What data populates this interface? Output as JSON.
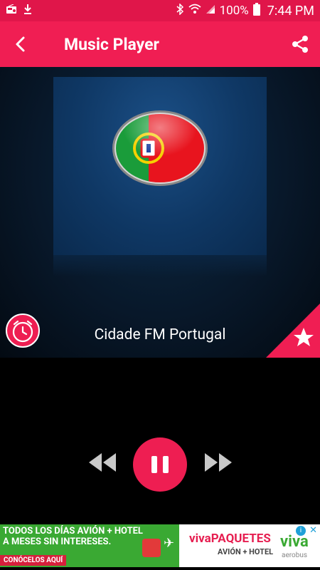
{
  "status_bar": {
    "battery_pct": "100%",
    "time": "7:44 PM",
    "left_icons": [
      "radio-icon",
      "download-icon"
    ],
    "right_icons": [
      "bluetooth-icon",
      "wifi-icon",
      "signal-icon",
      "battery-icon"
    ]
  },
  "app_bar": {
    "title": "Music Player",
    "back_icon": "back-arrow-icon",
    "share_icon": "share-icon"
  },
  "player": {
    "artwork_icon": "portugal-flag-badge",
    "station_name": "Cidade FM Portugal",
    "alarm_icon": "alarm-clock-icon",
    "favorite_icon": "star-icon"
  },
  "controls": {
    "rewind_icon": "rewind-icon",
    "pause_icon": "pause-icon",
    "fast_forward_icon": "fast-forward-icon"
  },
  "ad": {
    "line1": "TODOS LOS DÍAS AVIÓN + HOTEL",
    "line2": "A MESES SIN INTERESES.",
    "cta": "CONÓCELOS AQUÍ",
    "brand_prefix": "viva",
    "brand_suffix": "PAQUETES",
    "brand_sub": "AVIÓN + HOTEL",
    "logo": "viva",
    "logo_sub": "aerobus"
  },
  "colors": {
    "accent": "#f01e53",
    "status_bar": "#e0164a",
    "ad_green": "#3aa933"
  }
}
